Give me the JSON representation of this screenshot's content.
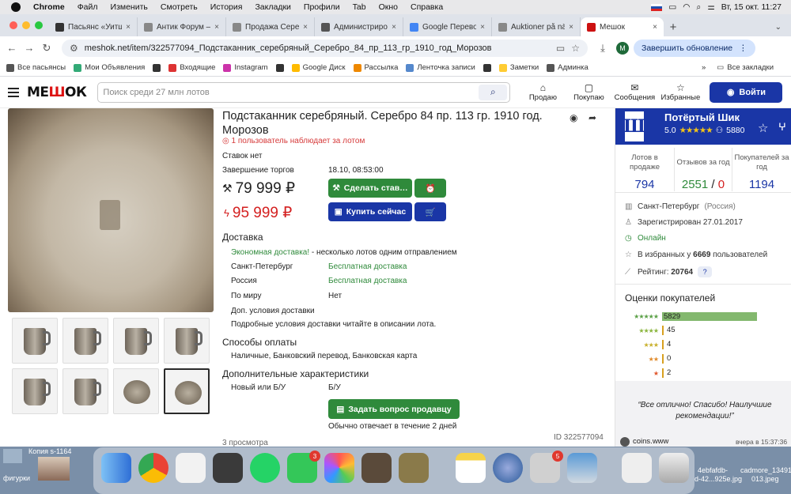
{
  "menubar": {
    "app": "Chrome",
    "items": [
      "Файл",
      "Изменить",
      "Смотреть",
      "История",
      "Закладки",
      "Профили",
      "Tab",
      "Окно",
      "Справка"
    ],
    "clock": "Вт, 15 окт.  11:27"
  },
  "tabs": [
    {
      "label": "Пасьянс «Уитш…",
      "color": "#333"
    },
    {
      "label": "Антик Форум – О",
      "color": "#888"
    },
    {
      "label": "Продажа Серебр",
      "color": "#888"
    },
    {
      "label": "Администрирова",
      "color": "#555"
    },
    {
      "label": "Google Переводч",
      "color": "#4285f4"
    },
    {
      "label": "Auktioner på nätet",
      "color": "#888"
    },
    {
      "label": "Мешок",
      "color": "#c11",
      "active": true
    }
  ],
  "address": {
    "url": "meshok.net/item/322577094_Подстаканник_серебряный_Серебро_84_пр_113_гр_1910_год_Морозов",
    "update": "Завершить обновление",
    "avatar": "M"
  },
  "bookmarks": [
    {
      "label": "Все пасьянсы",
      "color": "#555"
    },
    {
      "label": "Мои Объявления",
      "color": "#3a7"
    },
    {
      "label": "",
      "color": "#333"
    },
    {
      "label": "Входящие",
      "color": "#d33"
    },
    {
      "label": "Instagram",
      "color": "#c3a"
    },
    {
      "label": "",
      "color": "#333"
    },
    {
      "label": "Google Диск",
      "color": "#fb0"
    },
    {
      "label": "Рассылка",
      "color": "#e80"
    },
    {
      "label": "Ленточка записи",
      "color": "#58c"
    },
    {
      "label": "",
      "color": "#333"
    },
    {
      "label": "Заметки",
      "color": "#fc3"
    },
    {
      "label": "Админка",
      "color": "#555"
    }
  ],
  "bookmarks_all": "Все закладки",
  "header": {
    "logo_a": "МЕ",
    "logo_b": "Ш",
    "logo_c": "ОК",
    "search_placeholder": "Поиск среди 27 млн лотов",
    "actions": [
      "Продаю",
      "Покупаю",
      "Сообщения",
      "Избранные"
    ],
    "login": "Войти"
  },
  "item": {
    "title": "Подстаканник серебряный. Серебро 84 пр. 113 гр. 1910 год. Морозов",
    "watchers": "1 пользователь наблюдает за лотом",
    "bids": "Ставок нет",
    "end_label": "Завершение торгов",
    "end_value": "18.10, 08:53:00",
    "bid_price": "79 999 ₽",
    "buy_price": "95 999 ₽",
    "bid_button": "Сделать став…",
    "buy_button": "Купить сейчас",
    "delivery_title": "Доставка",
    "delivery_eco": "Экономная доставка!",
    "delivery_eco_rest": " - несколько лотов одним отправлением",
    "delivery_rows": [
      {
        "place": "Санкт-Петербург",
        "value": "Бесплатная доставка"
      },
      {
        "place": "Россия",
        "value": "Бесплатная доставка"
      },
      {
        "place": "По миру",
        "value": "Нет"
      },
      {
        "place": "Доп. условия доставки",
        "value": ""
      }
    ],
    "delivery_note": "Подробные условия доставки читайте в описании лота.",
    "payment_title": "Способы оплаты",
    "payment_value": "Наличные, Банковский перевод, Банковская карта",
    "extra_title": "Дополнительные характеристики",
    "extra_label": "Новый или Б/У",
    "extra_value": "Б/У",
    "ask_button": "Задать вопрос продавцу",
    "reply_note": "Обычно отвечает в течение 2 дней",
    "views": "3 просмотра",
    "item_id": "ID 322577094"
  },
  "seller": {
    "name": "Потёртый Шик",
    "logo_letter": "Ш",
    "rating": "5.0",
    "stars": "★★★★★",
    "followers": "5880",
    "stats": [
      {
        "label": "Лотов в продаже",
        "value": "794"
      },
      {
        "label": "Отзывов за год",
        "value": "2551",
        "value_bad": "0"
      },
      {
        "label": "Покупателей за год",
        "value": "1194"
      }
    ],
    "city": "Санкт-Петербург",
    "city_region": "(Россия)",
    "registered": "Зарегистрирован 27.01.2017",
    "online": "Онлайн",
    "fav_prefix": "В избранных у ",
    "fav_count": "6669",
    "fav_suffix": " пользователей",
    "rating_label": "Рейтинг: ",
    "rating_value": "20764",
    "reviews_title": "Оценки покупателей",
    "review_counts": [
      {
        "stars": "★★★★★",
        "count": "5829",
        "color": "#5aa046",
        "fraction": 1.0
      },
      {
        "stars": "★★★★",
        "count": "45",
        "color": "#8ab53c",
        "fraction": 0
      },
      {
        "stars": "★★★",
        "count": "4",
        "color": "#c8b02c",
        "fraction": 0
      },
      {
        "stars": "★★",
        "count": "0",
        "color": "#e08a2a",
        "fraction": 0
      },
      {
        "stars": "★",
        "count": "2",
        "color": "#e0552a",
        "fraction": 0
      }
    ],
    "quote": "“Все отлично! Спасибо! Наилучшие рекомендации!”",
    "reviewer": "coins.www",
    "review_time": "вчера в 15:37:36"
  },
  "desktop": {
    "left_label": "Копия s-1164",
    "left_label2": "фигурки",
    "right_label1": "4ebfafdb-",
    "right_label2": "d-42...925e.jpg",
    "right_label3": "cadmore_134912",
    "right_label4": "013.jpeg",
    "whatsapp_badge": "3",
    "app_badge": "5"
  }
}
